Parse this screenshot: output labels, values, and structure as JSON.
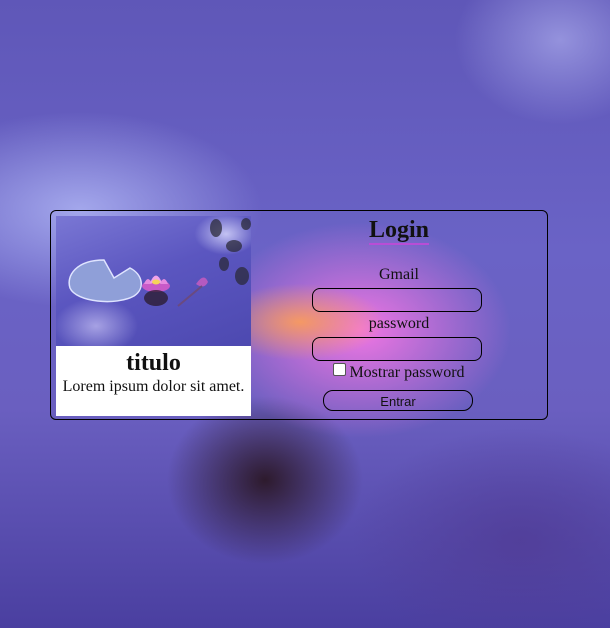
{
  "card": {
    "title": "titulo",
    "description": "Lorem ipsum dolor sit amet."
  },
  "form": {
    "title": "Login",
    "email_label": "Gmail",
    "email_value": "",
    "password_label": "password",
    "password_value": "",
    "show_password_label": "Mostrar password",
    "show_password_checked": false,
    "submit_label": "Entrar"
  },
  "icons": {
    "card_image": "water-lily-image",
    "checkbox": "checkbox-unchecked"
  },
  "colors": {
    "background": "#6a63c6",
    "title_underline": "#b94dd6",
    "card_background": "#ffffff"
  }
}
